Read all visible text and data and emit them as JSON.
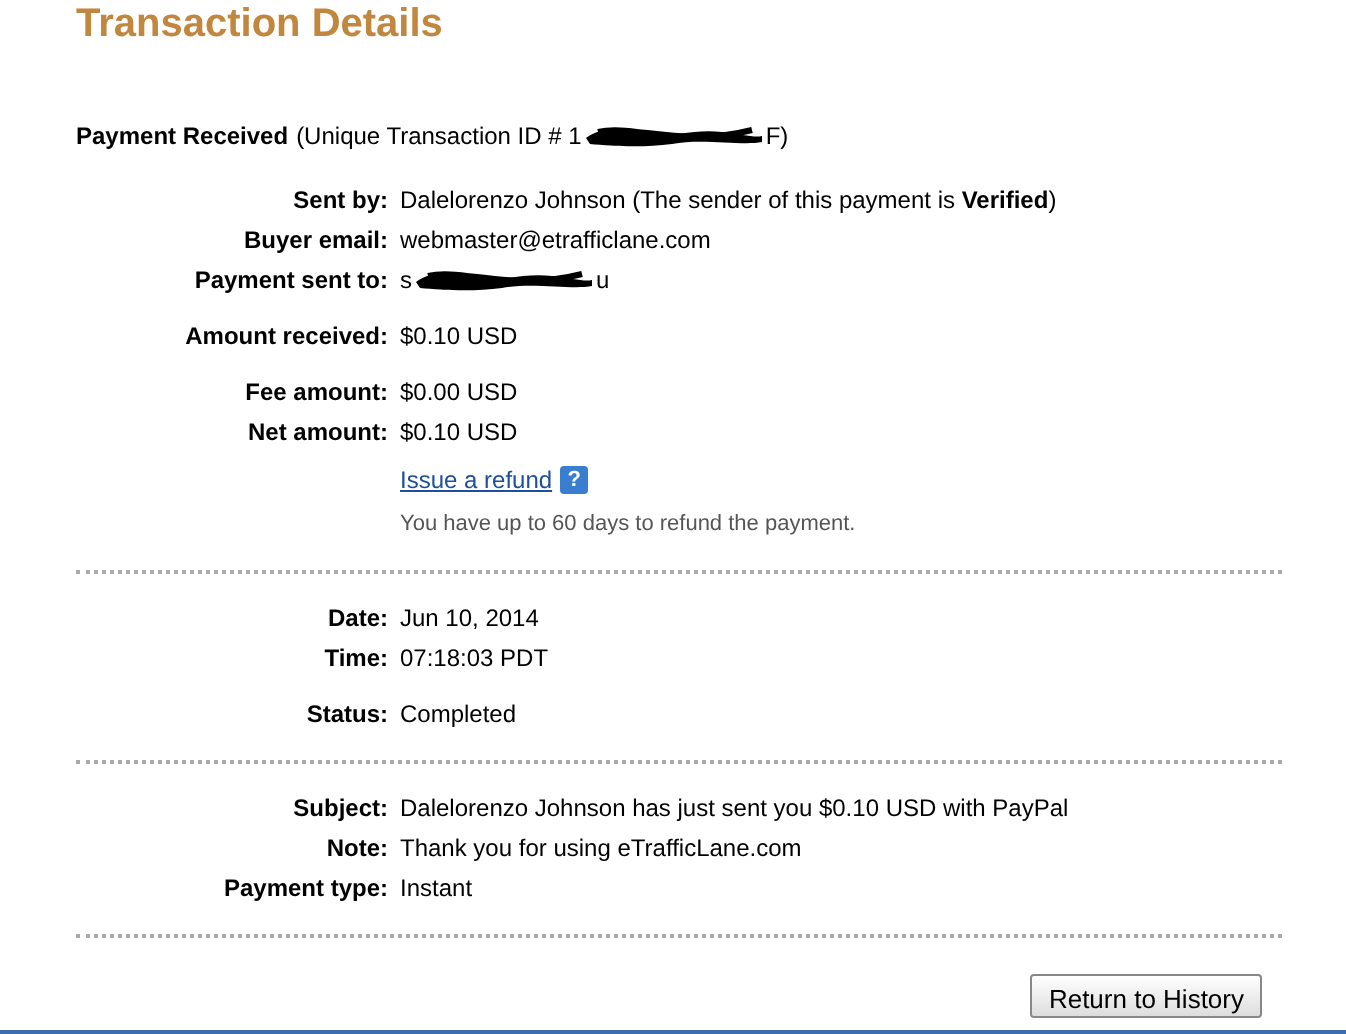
{
  "title": "Transaction Details",
  "header": {
    "label": "Payment Received",
    "id_prefix": "(Unique Transaction ID # 1",
    "id_suffix": "F)"
  },
  "sections": [
    {
      "groups": [
        [
          {
            "kind": "text",
            "label": "Sent by:",
            "value": "Dalelorenzo Johnson (The sender of this payment is **Verified**)"
          },
          {
            "kind": "text",
            "label": "Buyer email:",
            "value": "webmaster@etrafficlane.com"
          },
          {
            "kind": "redacted",
            "label": "Payment sent to:",
            "prefix": "s",
            "suffix": "u"
          }
        ],
        [
          {
            "kind": "text",
            "label": "Amount received:",
            "value": "$0.10 USD"
          }
        ],
        [
          {
            "kind": "text",
            "label": "Fee amount:",
            "value": "$0.00 USD"
          },
          {
            "kind": "text",
            "label": "Net amount:",
            "value": "$0.10 USD"
          },
          {
            "kind": "link",
            "link": "Issue a refund",
            "help": "?"
          },
          {
            "kind": "hint",
            "value": "You have up to 60 days to refund the payment."
          }
        ]
      ]
    },
    {
      "groups": [
        [
          {
            "kind": "text",
            "label": "Date:",
            "value": "Jun 10, 2014"
          },
          {
            "kind": "text",
            "label": "Time:",
            "value": "07:18:03 PDT"
          }
        ],
        [
          {
            "kind": "text",
            "label": "Status:",
            "value": "Completed"
          }
        ]
      ]
    },
    {
      "groups": [
        [
          {
            "kind": "text",
            "label": "Subject:",
            "value": "Dalelorenzo Johnson has just sent you $0.10 USD with PayPal"
          },
          {
            "kind": "text",
            "label": "Note:",
            "value": "Thank you for using eTrafficLane.com"
          },
          {
            "kind": "text",
            "label": "Payment type:",
            "value": "Instant"
          }
        ]
      ]
    }
  ],
  "button": "Return to History"
}
